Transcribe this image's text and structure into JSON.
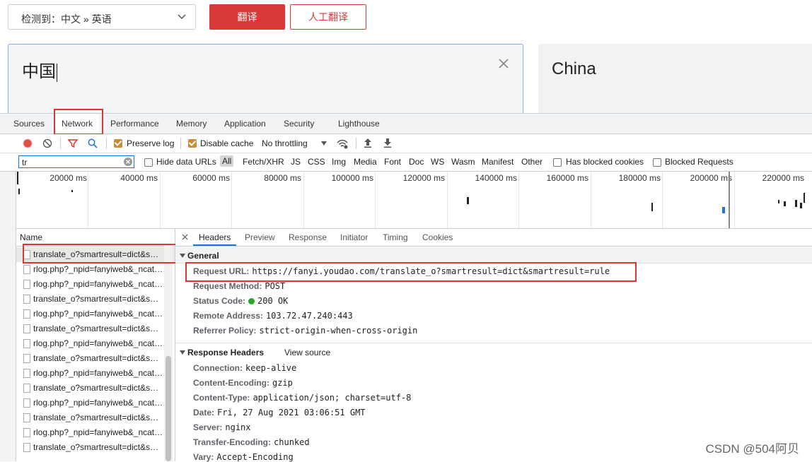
{
  "translator": {
    "lang_select": "检测到：中文 » 英语",
    "translate_button": "翻译",
    "human_translate_button": "人工翻译",
    "input_text": "中国",
    "output_text": "China"
  },
  "devtools": {
    "tabs": [
      "Sources",
      "Network",
      "Performance",
      "Memory",
      "Application",
      "Security",
      "Lighthouse"
    ],
    "active_tab": "Network",
    "toolbar": {
      "preserve_log": "Preserve log",
      "disable_cache": "Disable cache",
      "throttling": "No throttling"
    },
    "filter": {
      "value": "tr",
      "hide_data_urls": "Hide data URLs",
      "types": [
        "All",
        "Fetch/XHR",
        "JS",
        "CSS",
        "Img",
        "Media",
        "Font",
        "Doc",
        "WS",
        "Wasm",
        "Manifest",
        "Other"
      ],
      "has_blocked_cookies": "Has blocked cookies",
      "blocked_requests": "Blocked Requests"
    },
    "timeline_ticks": [
      "20000 ms",
      "40000 ms",
      "60000 ms",
      "80000 ms",
      "100000 ms",
      "120000 ms",
      "140000 ms",
      "160000 ms",
      "180000 ms",
      "200000 ms",
      "220000 ms"
    ],
    "name_header": "Name",
    "requests": [
      "translate_o?smartresult=dict&smartresult=rule",
      "rlog.php?_npid=fanyiweb&_ncat=event",
      "rlog.php?_npid=fanyiweb&_ncat=event",
      "translate_o?smartresult=dict&smartresult=rule",
      "rlog.php?_npid=fanyiweb&_ncat=event",
      "translate_o?smartresult=dict&smartresult=rule",
      "rlog.php?_npid=fanyiweb&_ncat=event",
      "translate_o?smartresult=dict&smartresult=rule",
      "rlog.php?_npid=fanyiweb&_ncat=event",
      "translate_o?smartresult=dict&smartresult=rule",
      "rlog.php?_npid=fanyiweb&_ncat=event",
      "translate_o?smartresult=dict&smartresult=rule",
      "rlog.php?_npid=fanyiweb&_ncat=event",
      "translate_o?smartresult=dict&smartresult=rule"
    ],
    "detail_tabs": [
      "Headers",
      "Preview",
      "Response",
      "Initiator",
      "Timing",
      "Cookies"
    ],
    "general_title": "General",
    "general": [
      {
        "k": "Request URL:",
        "v": "https://fanyi.youdao.com/translate_o?smartresult=dict&smartresult=rule"
      },
      {
        "k": "Request Method:",
        "v": "POST"
      },
      {
        "k": "Status Code:",
        "v": "200 OK"
      },
      {
        "k": "Remote Address:",
        "v": "103.72.47.240:443"
      },
      {
        "k": "Referrer Policy:",
        "v": "strict-origin-when-cross-origin"
      }
    ],
    "response_headers_title": "Response Headers",
    "view_source": "View source",
    "response_headers": [
      {
        "k": "Connection:",
        "v": "keep-alive"
      },
      {
        "k": "Content-Encoding:",
        "v": "gzip"
      },
      {
        "k": "Content-Type:",
        "v": "application/json; charset=utf-8"
      },
      {
        "k": "Date:",
        "v": "Fri, 27 Aug 2021 03:06:51 GMT"
      },
      {
        "k": "Server:",
        "v": "nginx"
      },
      {
        "k": "Transfer-Encoding:",
        "v": "chunked"
      },
      {
        "k": "Vary:",
        "v": "Accept-Encoding"
      }
    ]
  },
  "watermark": "CSDN @504阿贝",
  "colors": {
    "accent_red": "#d73a37",
    "highlight_red": "#d8382f",
    "status_green": "#2aa42a"
  }
}
